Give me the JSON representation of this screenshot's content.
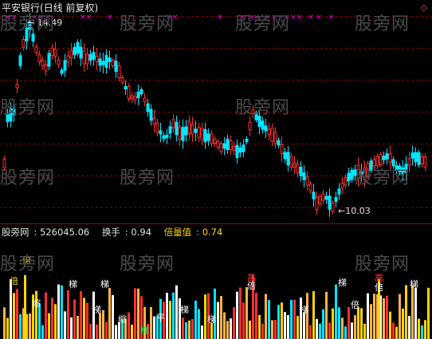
{
  "header": {
    "stock": "平安银行",
    "period": "(日线 前复权)",
    "diamond": "◇"
  },
  "price_panel": {
    "high_label": "14.49",
    "low_label": "10.03",
    "up_color": "#ff3030",
    "down_color": "#00e5ff",
    "grid_color": "#8b0000",
    "marker_color": "#ff00ff"
  },
  "indicator": {
    "name": "股旁网",
    "value": ": 526045.06",
    "turnover_label": "换手",
    "turnover_value": ": 0.94",
    "ratio_label": "倍量值",
    "ratio_value": ": 0.74"
  },
  "watermarks": [
    "股旁网",
    "股旁网",
    "股旁网",
    "股旁网",
    "股旁网",
    "股旁网",
    "股旁网",
    "股旁网",
    "股旁网",
    "股旁网",
    "股旁网",
    "股旁网"
  ],
  "volume_tags": {
    "bei": "倍",
    "ti": "梯",
    "gao": "高",
    "ping": "平",
    "suo": "缩"
  },
  "chart_data": {
    "type": "candlestick",
    "title": "平安银行(日线 前复权)",
    "high": 14.49,
    "low": 10.03,
    "ylim": [
      9.8,
      14.8
    ]
  }
}
